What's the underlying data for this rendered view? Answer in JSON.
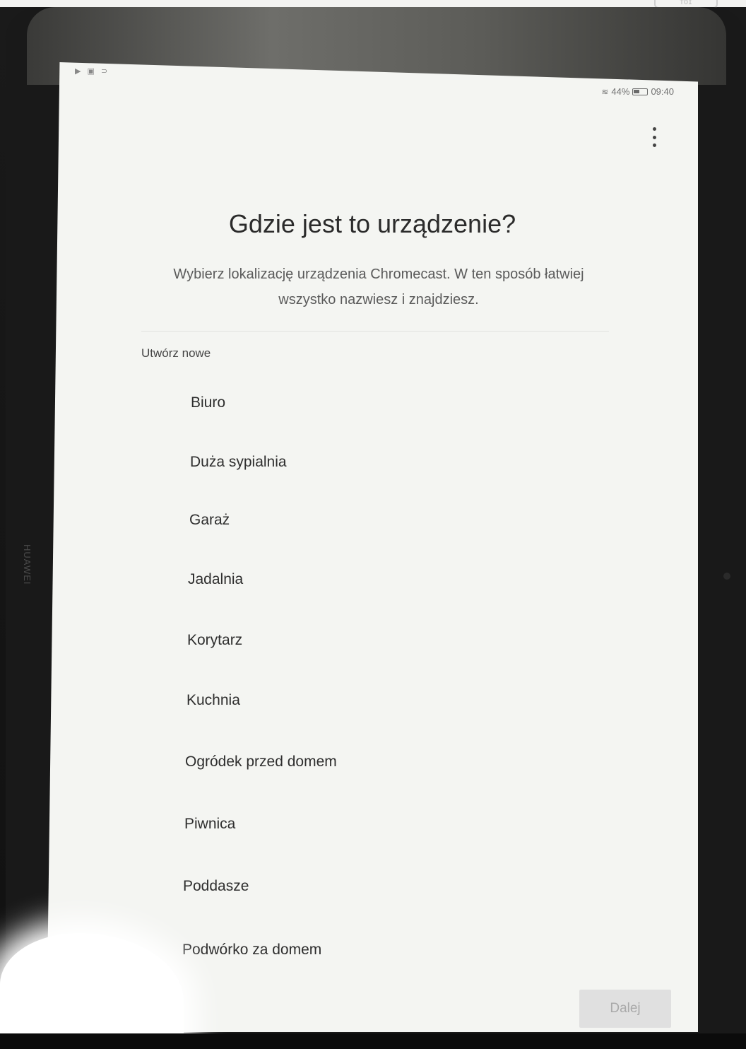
{
  "device": {
    "brand": "HUAWEI",
    "corner_label": "TOI"
  },
  "status_bar": {
    "left_icons": "▶ ▣ ⊃",
    "wifi_icon": "wifi-icon",
    "battery_percent": "44%",
    "time": "09:40"
  },
  "header": {
    "menu_icon": "more-vert-icon",
    "title": "Gdzie jest to urządzenie?",
    "subtitle": "Wybierz lokalizację urządzenia Chromecast. W ten sposób łatwiej wszystko nazwiesz i znajdziesz."
  },
  "list": {
    "section_label": "Utwórz nowe",
    "items": [
      "Biuro",
      "Duża sypialnia",
      "Garaż",
      "Jadalnia",
      "Korytarz",
      "Kuchnia",
      "Ogródek przed domem",
      "Piwnica",
      "Poddasze",
      "Podwórko za domem"
    ]
  },
  "footer": {
    "next_label": "Dalej"
  }
}
